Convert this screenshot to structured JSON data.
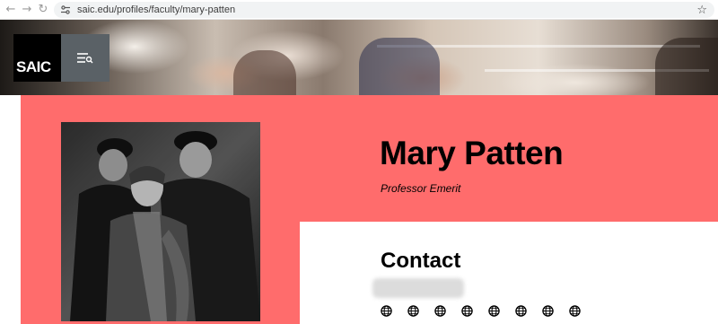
{
  "browser": {
    "url": "saic.edu/profiles/faculty/mary-patten"
  },
  "site": {
    "logo_text": "SAIC"
  },
  "profile": {
    "name": "Mary Patten",
    "title": "Professor Emerit",
    "contact_heading": "Contact"
  },
  "colors": {
    "accent": "#ff6c6c",
    "logo_bg": "#000000",
    "menu_bg": "#5a6166"
  },
  "icons": [
    "back-icon",
    "forward-icon",
    "reload-icon",
    "site-info-icon",
    "bookmark-star-icon",
    "menu-search-icon",
    "globe-icon"
  ]
}
